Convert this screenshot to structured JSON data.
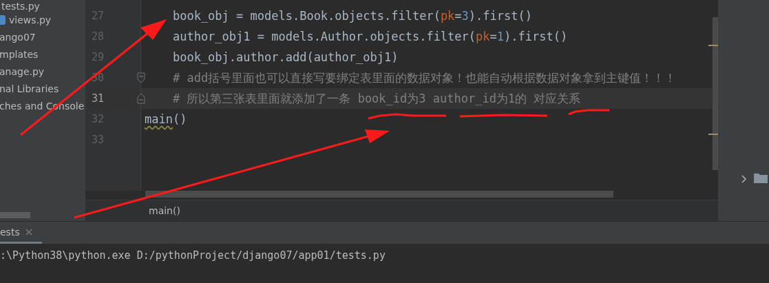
{
  "sidebar": {
    "items": [
      {
        "label": "tests.py",
        "icon": false
      },
      {
        "label": "views.py",
        "icon": true
      },
      {
        "label": "ango07",
        "icon": false
      },
      {
        "label": "mplates",
        "icon": false
      },
      {
        "label": "anage.py",
        "icon": false
      },
      {
        "label": "nal Libraries",
        "icon": false
      },
      {
        "label": "ches and Console",
        "icon": false
      }
    ]
  },
  "editor": {
    "lines": [
      {
        "number": "27",
        "kind": "plain",
        "current": false,
        "tokens": [
          {
            "kind": "plain",
            "text": "    book_obj = models.Book.objects.filter("
          },
          {
            "kind": "param",
            "text": "pk"
          },
          {
            "kind": "plain",
            "text": "="
          },
          {
            "kind": "number",
            "text": "3"
          },
          {
            "kind": "plain",
            "text": ").first()"
          }
        ]
      },
      {
        "number": "28",
        "kind": "plain",
        "current": false,
        "tokens": [
          {
            "kind": "plain",
            "text": "    author_obj1 = models.Author.objects.filter("
          },
          {
            "kind": "param",
            "text": "pk"
          },
          {
            "kind": "plain",
            "text": "="
          },
          {
            "kind": "number",
            "text": "1"
          },
          {
            "kind": "plain",
            "text": ").first()"
          }
        ]
      },
      {
        "number": "29",
        "kind": "plain",
        "current": false,
        "tokens": [
          {
            "kind": "plain",
            "text": "    book_obj.author.add(author_obj1)"
          }
        ]
      },
      {
        "number": "30",
        "kind": "fold_start",
        "current": false,
        "tokens": [
          {
            "kind": "comment",
            "text": "    # add括号里面也可以直接写要绑定表里面的数据对象！也能自动根据数据对象拿到主键值！！！"
          }
        ]
      },
      {
        "number": "31",
        "kind": "fold_end",
        "current": true,
        "tokens": [
          {
            "kind": "comment",
            "text": "    # 所以第三张表里面就添加了一条 book_id为3 author_id为1的 对应关系"
          }
        ]
      },
      {
        "number": "32",
        "kind": "plain",
        "current": false,
        "tokens": [
          {
            "kind": "warning",
            "text": "main"
          },
          {
            "kind": "plain",
            "text": "()"
          }
        ]
      },
      {
        "number": "33",
        "kind": "plain",
        "current": false
      }
    ]
  },
  "breadcrumb": "main()",
  "tool_window": {
    "tabs": [
      {
        "label": "ests",
        "selected": true
      }
    ]
  },
  "console": {
    "lines": [
      ":\\Python38\\python.exe D:/pythonProject/django07/app01/tests.py"
    ]
  }
}
